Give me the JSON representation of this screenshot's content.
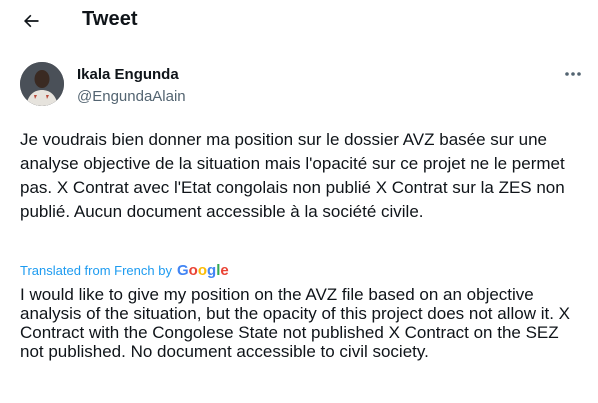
{
  "header": {
    "back_icon": "arrow-left-icon",
    "title": "Tweet"
  },
  "tweet": {
    "author": {
      "display_name": "Ikala Engunda",
      "handle": "@EngundaAlain",
      "avatar_icon": "user-avatar"
    },
    "more_icon": "ellipsis-icon",
    "text": "Je voudrais bien donner ma position sur le dossier AVZ basée sur une analyse objective de la situation mais l'opacité sur ce projet ne le permet pas. X Contrat avec l'Etat congolais non publié X Contrat sur la ZES non publié. Aucun document accessible à la société civile.",
    "translation": {
      "label": "Translated from French by",
      "provider": "Google",
      "text": "I would like to give my position on the AVZ file based on an objective analysis of the situation, but the opacity of this project does not allow it. X Contract with the Congolese State not published X Contract on the SEZ not published. No document accessible to civil society."
    }
  },
  "colors": {
    "text": "#0f1419",
    "muted": "#536471",
    "link": "#1d9bf0"
  }
}
